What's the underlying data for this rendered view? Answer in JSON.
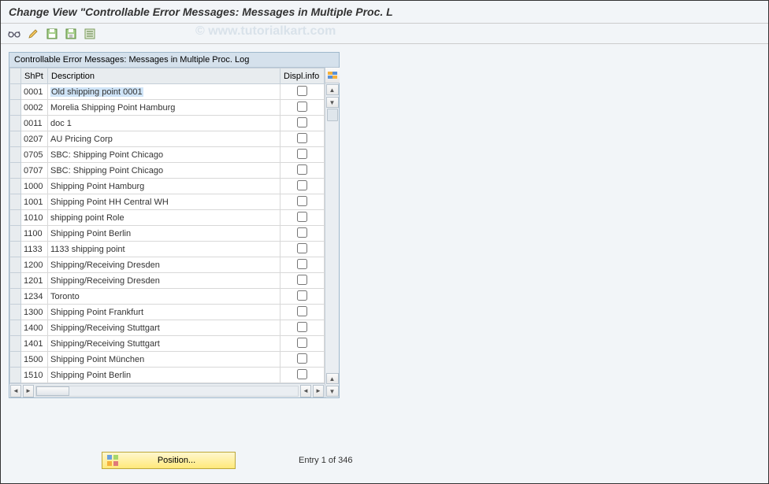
{
  "header": {
    "title": "Change View \"Controllable Error Messages: Messages in Multiple Proc. L"
  },
  "watermark": "© www.tutorialkart.com",
  "toolbar": {
    "icons": [
      "glasses-icon",
      "pencil-icon",
      "save-icon",
      "save-variant-icon",
      "list-icon"
    ]
  },
  "panel": {
    "title": "Controllable Error Messages: Messages in Multiple Proc. Log",
    "columns": {
      "shpt": "ShPt",
      "description": "Description",
      "displinfo": "Displ.info"
    },
    "rows": [
      {
        "shpt": "0001",
        "desc": "Old shipping point 0001",
        "disp": false,
        "selected": true
      },
      {
        "shpt": "0002",
        "desc": "Morelia Shipping Point Hamburg",
        "disp": false
      },
      {
        "shpt": "0011",
        "desc": "doc 1",
        "disp": false
      },
      {
        "shpt": "0207",
        "desc": "AU Pricing Corp",
        "disp": false
      },
      {
        "shpt": "0705",
        "desc": "SBC: Shipping Point Chicago",
        "disp": false
      },
      {
        "shpt": "0707",
        "desc": "SBC: Shipping Point Chicago",
        "disp": false
      },
      {
        "shpt": "1000",
        "desc": "Shipping Point Hamburg",
        "disp": false
      },
      {
        "shpt": "1001",
        "desc": "Shipping Point HH Central WH",
        "disp": false
      },
      {
        "shpt": "1010",
        "desc": "shipping point Role",
        "disp": false
      },
      {
        "shpt": "1100",
        "desc": "Shipping Point Berlin",
        "disp": false
      },
      {
        "shpt": "1133",
        "desc": "1133 shipping point",
        "disp": false
      },
      {
        "shpt": "1200",
        "desc": "Shipping/Receiving Dresden",
        "disp": false
      },
      {
        "shpt": "1201",
        "desc": "Shipping/Receiving Dresden",
        "disp": false
      },
      {
        "shpt": "1234",
        "desc": "Toronto",
        "disp": false
      },
      {
        "shpt": "1300",
        "desc": "Shipping Point Frankfurt",
        "disp": false
      },
      {
        "shpt": "1400",
        "desc": "Shipping/Receiving Stuttgart",
        "disp": false
      },
      {
        "shpt": "1401",
        "desc": "Shipping/Receiving Stuttgart",
        "disp": false
      },
      {
        "shpt": "1500",
        "desc": "Shipping Point München",
        "disp": false
      },
      {
        "shpt": "1510",
        "desc": "Shipping Point Berlin",
        "disp": false
      }
    ]
  },
  "footer": {
    "position_label": "Position...",
    "entry_text": "Entry 1 of 346"
  }
}
